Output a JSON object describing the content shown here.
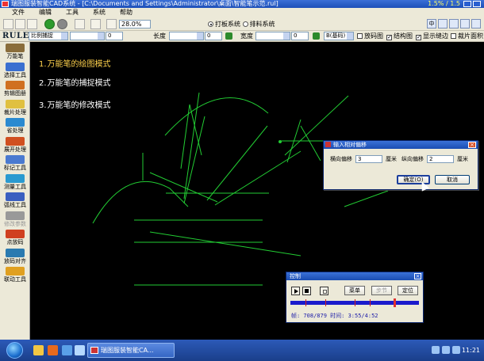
{
  "window": {
    "title": "瑞图服装智能CAD系统 - [C:\\Documents and Settings\\Administrator\\桌面\\智能笔示范.rul]",
    "speed_readout": "1.5% / 1.5"
  },
  "menu": [
    "文件",
    "编辑",
    "工具",
    "系统",
    "帮助"
  ],
  "toolbar": {
    "zoom_value": "28.0%",
    "radio_options": [
      {
        "label": "打板系统",
        "selected": true
      },
      {
        "label": "排料系统",
        "selected": false
      }
    ],
    "right_icons": [
      "中",
      "ime-icon",
      "moon-icon",
      "pen-icon",
      "help-icon"
    ]
  },
  "toolbar2": {
    "logo": "RULE",
    "snap_mode": "比例捕捉",
    "snap_value": "0",
    "length_label": "长度",
    "length_value": "0",
    "width_label": "宽度",
    "width_value": "0",
    "unit_select": "B(基码)",
    "checkboxes": [
      {
        "label": "放码图",
        "checked": false
      },
      {
        "label": "结构图",
        "checked": true
      },
      {
        "label": "显示缝边",
        "checked": true
      },
      {
        "label": "裁片面积",
        "checked": false
      }
    ]
  },
  "sidebar": [
    {
      "label": "万能笔",
      "icon": "pen-tool-icon",
      "color": "#8a6d3b",
      "enabled": true
    },
    {
      "label": "选择工具",
      "icon": "select-tool-icon",
      "color": "#3a6fd0",
      "enabled": true
    },
    {
      "label": "剪辑图册",
      "icon": "clip-tool-icon",
      "color": "#d07020",
      "enabled": true
    },
    {
      "label": "裁片处理",
      "icon": "piece-tool-icon",
      "color": "#e0c040",
      "enabled": true
    },
    {
      "label": "省处理",
      "icon": "dart-tool-icon",
      "color": "#2a8ad0",
      "enabled": true
    },
    {
      "label": "展开处理",
      "icon": "expand-tool-icon",
      "color": "#d05020",
      "enabled": true
    },
    {
      "label": "标记工具",
      "icon": "mark-tool-icon",
      "color": "#4a7ad0",
      "enabled": true
    },
    {
      "label": "测量工具",
      "icon": "measure-tool-icon",
      "color": "#2a9ad0",
      "enabled": true
    },
    {
      "label": "弧线工具",
      "icon": "arc-tool-icon",
      "color": "#3a5fc0",
      "enabled": true
    },
    {
      "label": "修改参数",
      "icon": "param-tool-icon",
      "color": "#999999",
      "enabled": false
    },
    {
      "label": "点放码",
      "icon": "point-grade-icon",
      "color": "#d04020",
      "enabled": true
    },
    {
      "label": "放码对齐",
      "icon": "grade-align-icon",
      "color": "#2a7ab0",
      "enabled": true
    },
    {
      "label": "联动工具",
      "icon": "link-tool-icon",
      "color": "#e0a020",
      "enabled": true
    }
  ],
  "canvas": {
    "modes": [
      {
        "index": "1.",
        "text": "万能笔的绘图模式",
        "active": true
      },
      {
        "index": "2.",
        "text": "万能笔的捕捉模式",
        "active": false
      },
      {
        "index": "3.",
        "text": "万能笔的修改模式",
        "active": false
      }
    ],
    "line_color": "#22cc33",
    "active_color": "#ffd24d"
  },
  "dialog": {
    "title": "输入相对偏移",
    "h_label": "横向偏移",
    "h_value": "3",
    "h_unit": "厘米",
    "v_label": "纵向偏移",
    "v_value": "2",
    "v_unit": "厘米",
    "ok_label": "确定(O)",
    "cancel_label": "取消"
  },
  "control": {
    "title": "控制",
    "menu_label": "菜单",
    "step_label": "步节",
    "locate_label": "定位",
    "status": "帧: 708/879 时间: 3:55/4:52",
    "progress": 0.806
  },
  "taskbar": {
    "task_label": "瑞图服装智能CA...",
    "clock": "11:21"
  }
}
